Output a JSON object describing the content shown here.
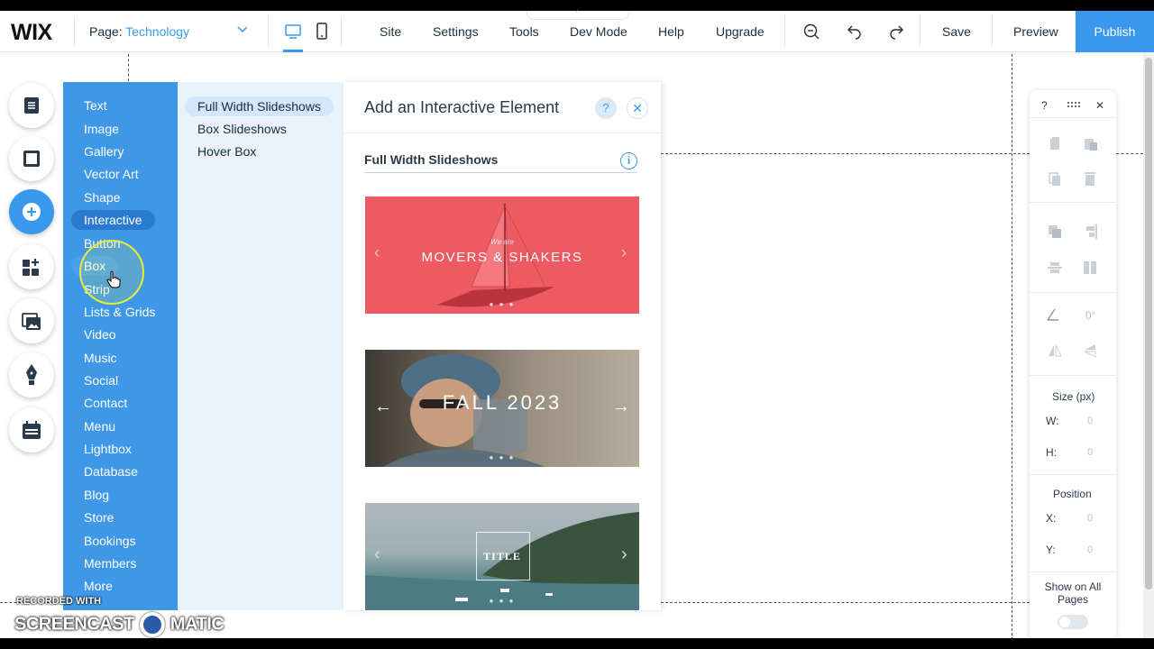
{
  "topbar": {
    "logo": "WIX",
    "page_label": "Page:",
    "page_name": "Technology",
    "menu": [
      "Site",
      "Settings",
      "Tools",
      "Dev Mode",
      "Help",
      "Upgrade"
    ],
    "save_label": "Save",
    "preview_label": "Preview",
    "publish_label": "Publish",
    "accent_color": "#3899ec"
  },
  "left_rail": {
    "icons": [
      "pages-icon",
      "background-icon",
      "add-icon",
      "app-market-icon",
      "media-icon",
      "blog-pen-icon",
      "bookings-icon"
    ],
    "active": "add-icon"
  },
  "categories": {
    "items": [
      "Text",
      "Image",
      "Gallery",
      "Vector Art",
      "Shape",
      "Interactive",
      "Button",
      "Box",
      "Strip",
      "Lists & Grids",
      "Video",
      "Music",
      "Social",
      "Contact",
      "Menu",
      "Lightbox",
      "Database",
      "Blog",
      "Store",
      "Bookings",
      "Members",
      "More"
    ],
    "selected": "Interactive",
    "hovered": "Box"
  },
  "subcategories": {
    "items": [
      "Full Width Slideshows",
      "Box Slideshows",
      "Hover Box"
    ],
    "selected": "Full Width Slideshows"
  },
  "panel": {
    "title": "Add an Interactive Element",
    "help": "?",
    "close": "✕",
    "section_title": "Full Width Slideshows",
    "info": "i",
    "slides": [
      {
        "small": "We are",
        "caption": "MOVERS & SHAKERS"
      },
      {
        "small": "",
        "caption": "FALL 2023"
      },
      {
        "small": "",
        "caption": "TITLE"
      }
    ]
  },
  "right_panel": {
    "help": "?",
    "close": "✕",
    "rotation": "0°",
    "size_title": "Size (px)",
    "w_label": "W:",
    "w_value": "0",
    "h_label": "H:",
    "h_value": "0",
    "position_title": "Position",
    "x_label": "X:",
    "x_value": "0",
    "y_label": "Y:",
    "y_value": "0",
    "show_all_pages": "Show on All Pages"
  },
  "watermark": {
    "line1": "RECORDED WITH",
    "line2": "SCREENCAST",
    "line3": "MATIC"
  }
}
